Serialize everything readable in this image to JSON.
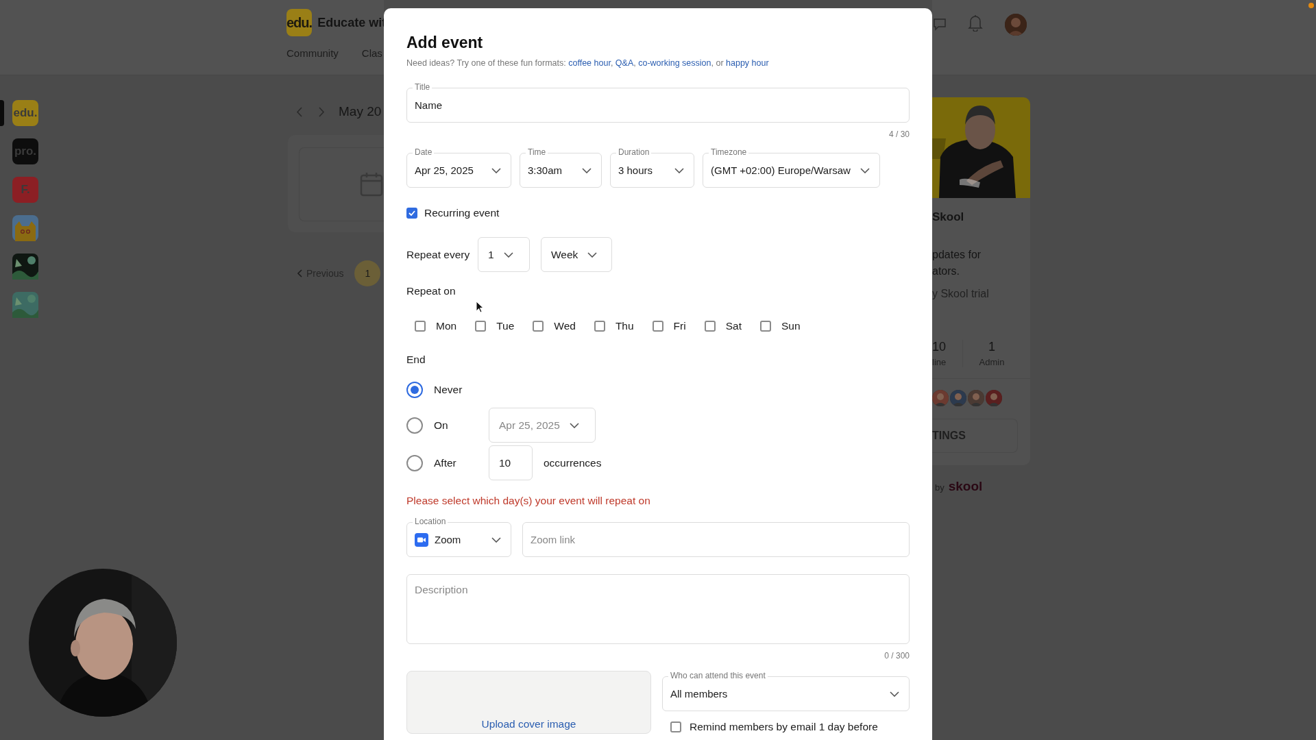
{
  "header": {
    "logo": "edu.",
    "community_name": "Educate wit",
    "nav": [
      "Community",
      "Clas"
    ]
  },
  "sidebar": {
    "communities": [
      {
        "kind": "text",
        "label": "edu.",
        "color": "#9a7f16",
        "selected": true
      },
      {
        "kind": "text",
        "label": "pro.",
        "color": "#0d0d0d",
        "selected": false
      },
      {
        "kind": "text",
        "label": "F.",
        "color": "#8c1f24",
        "selected": false
      },
      {
        "kind": "cat",
        "color": "#4b6d8e",
        "selected": false
      },
      {
        "kind": "picture",
        "color": "#0f1712",
        "selected": false
      },
      {
        "kind": "picture",
        "color": "#3d6b63",
        "selected": false
      }
    ]
  },
  "calendar": {
    "month": "May 20",
    "previous": "Previous",
    "pages": [
      {
        "label": "1",
        "selected": true
      }
    ]
  },
  "about_card": {
    "title": "Skool",
    "description_lines": [
      "pdates for",
      "ators."
    ],
    "note": "y Skool trial",
    "stats": [
      {
        "value": "10",
        "label": "line"
      },
      {
        "value": "1",
        "label": "Admin"
      }
    ],
    "button": "TINGS",
    "powered_by": "by",
    "brand": "skool"
  },
  "modal": {
    "title": "Add event",
    "hint": [
      {
        "kind": "text",
        "text": "Need ideas? Try one of these fun formats: "
      },
      {
        "kind": "link",
        "text": "coffee hour"
      },
      {
        "kind": "text",
        "text": ", "
      },
      {
        "kind": "link",
        "text": "Q&A"
      },
      {
        "kind": "text",
        "text": ", "
      },
      {
        "kind": "link",
        "text": "co-working session"
      },
      {
        "kind": "text",
        "text": ", or "
      },
      {
        "kind": "link",
        "text": "happy hour"
      }
    ],
    "title_field": {
      "label": "Title",
      "value": "Name",
      "counter": "4 / 30"
    },
    "schedule": [
      {
        "label": "Date",
        "value": "Apr 25, 2025"
      },
      {
        "label": "Time",
        "value": "3:30am"
      },
      {
        "label": "Duration",
        "value": "3 hours"
      },
      {
        "label": "Timezone",
        "value": "(GMT +02:00) Europe/Warsaw"
      }
    ],
    "recurring": {
      "label": "Recurring event",
      "checked": true
    },
    "repeat_every": {
      "label": "Repeat every",
      "interval": "1",
      "unit": "Week"
    },
    "repeat_on": {
      "label": "Repeat on",
      "days": [
        {
          "label": "Mon",
          "checked": false
        },
        {
          "label": "Tue",
          "checked": false
        },
        {
          "label": "Wed",
          "checked": false
        },
        {
          "label": "Thu",
          "checked": false
        },
        {
          "label": "Fri",
          "checked": false
        },
        {
          "label": "Sat",
          "checked": false
        },
        {
          "label": "Sun",
          "checked": false
        }
      ]
    },
    "end": {
      "label": "End",
      "options": [
        {
          "kind": "none",
          "label": "Never",
          "selected": true
        },
        {
          "kind": "date",
          "label": "On",
          "selected": false,
          "value": "Apr 25, 2025",
          "disabled": true
        },
        {
          "kind": "count",
          "label": "After",
          "selected": false,
          "value": "10",
          "disabled": false,
          "suffix": "occurrences"
        }
      ]
    },
    "error": "Please select which day(s) your event will repeat on",
    "location": {
      "label": "Location",
      "value": "Zoom",
      "link_placeholder": "Zoom link"
    },
    "description": {
      "placeholder": "Description",
      "counter": "0 / 300"
    },
    "cover": {
      "label": "Upload cover image"
    },
    "attendance": {
      "label": "Who can attend this event",
      "value": "All members"
    },
    "remind": {
      "label": "Remind members by email 1 day before",
      "checked": false
    }
  }
}
